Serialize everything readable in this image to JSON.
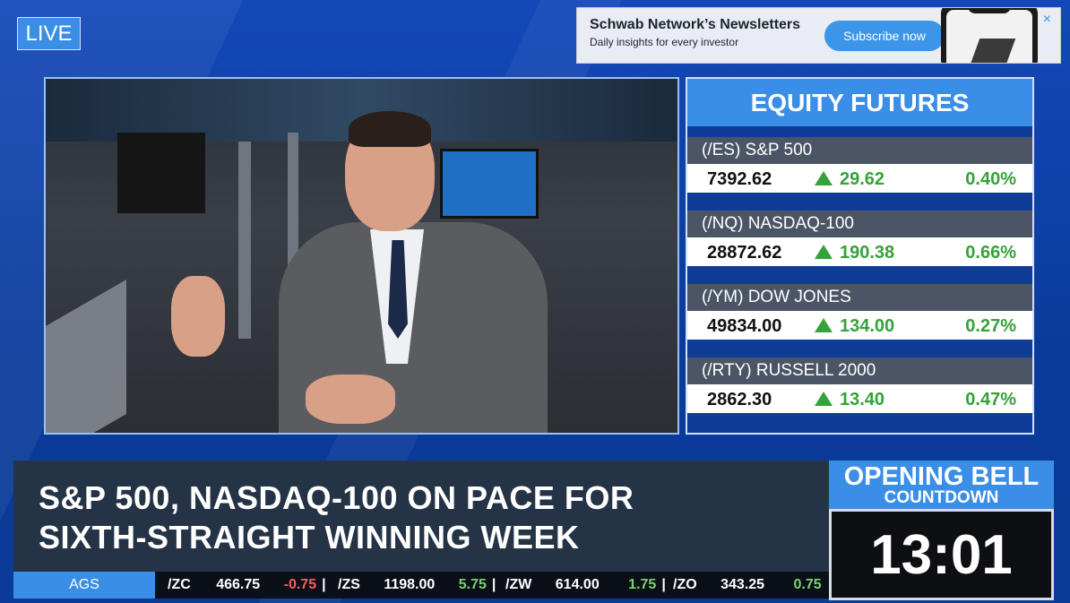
{
  "live_badge": "LIVE",
  "newsletter": {
    "title": "Schwab Network’s Newsletters",
    "subtitle": "Daily insights for every investor",
    "button": "Subscribe now",
    "close": "×"
  },
  "futures": {
    "header": "EQUITY FUTURES",
    "rows": [
      {
        "name": "(/ES) S&P 500",
        "price": "7392.62",
        "change": "29.62",
        "pct": "0.40%"
      },
      {
        "name": "(/NQ) NASDAQ-100",
        "price": "28872.62",
        "change": "190.38",
        "pct": "0.66%"
      },
      {
        "name": "(/YM) DOW JONES",
        "price": "49834.00",
        "change": "134.00",
        "pct": "0.27%"
      },
      {
        "name": "(/RTY) RUSSELL 2000",
        "price": "2862.30",
        "change": "13.40",
        "pct": "0.47%"
      }
    ]
  },
  "headline": {
    "line1": "S&P 500, NASDAQ-100 ON PACE FOR",
    "line2": "SIXTH-STRAIGHT WINNING WEEK"
  },
  "ticker": {
    "category": "AGS",
    "items": [
      {
        "symbol": "/ZC",
        "price": "466.75",
        "change": "-0.75",
        "dir": "neg"
      },
      {
        "symbol": "/ZS",
        "price": "1198.00",
        "change": "5.75",
        "dir": "pos"
      },
      {
        "symbol": "/ZW",
        "price": "614.00",
        "change": "1.75",
        "dir": "pos"
      },
      {
        "symbol": "/ZO",
        "price": "343.25",
        "change": "0.75",
        "dir": "pos"
      }
    ]
  },
  "countdown": {
    "line1": "OPENING BELL",
    "line2": "COUNTDOWN",
    "time": "13:01"
  },
  "colors": {
    "accent": "#3a8ee6",
    "up": "#35a23a",
    "down": "#ff5a5a"
  }
}
